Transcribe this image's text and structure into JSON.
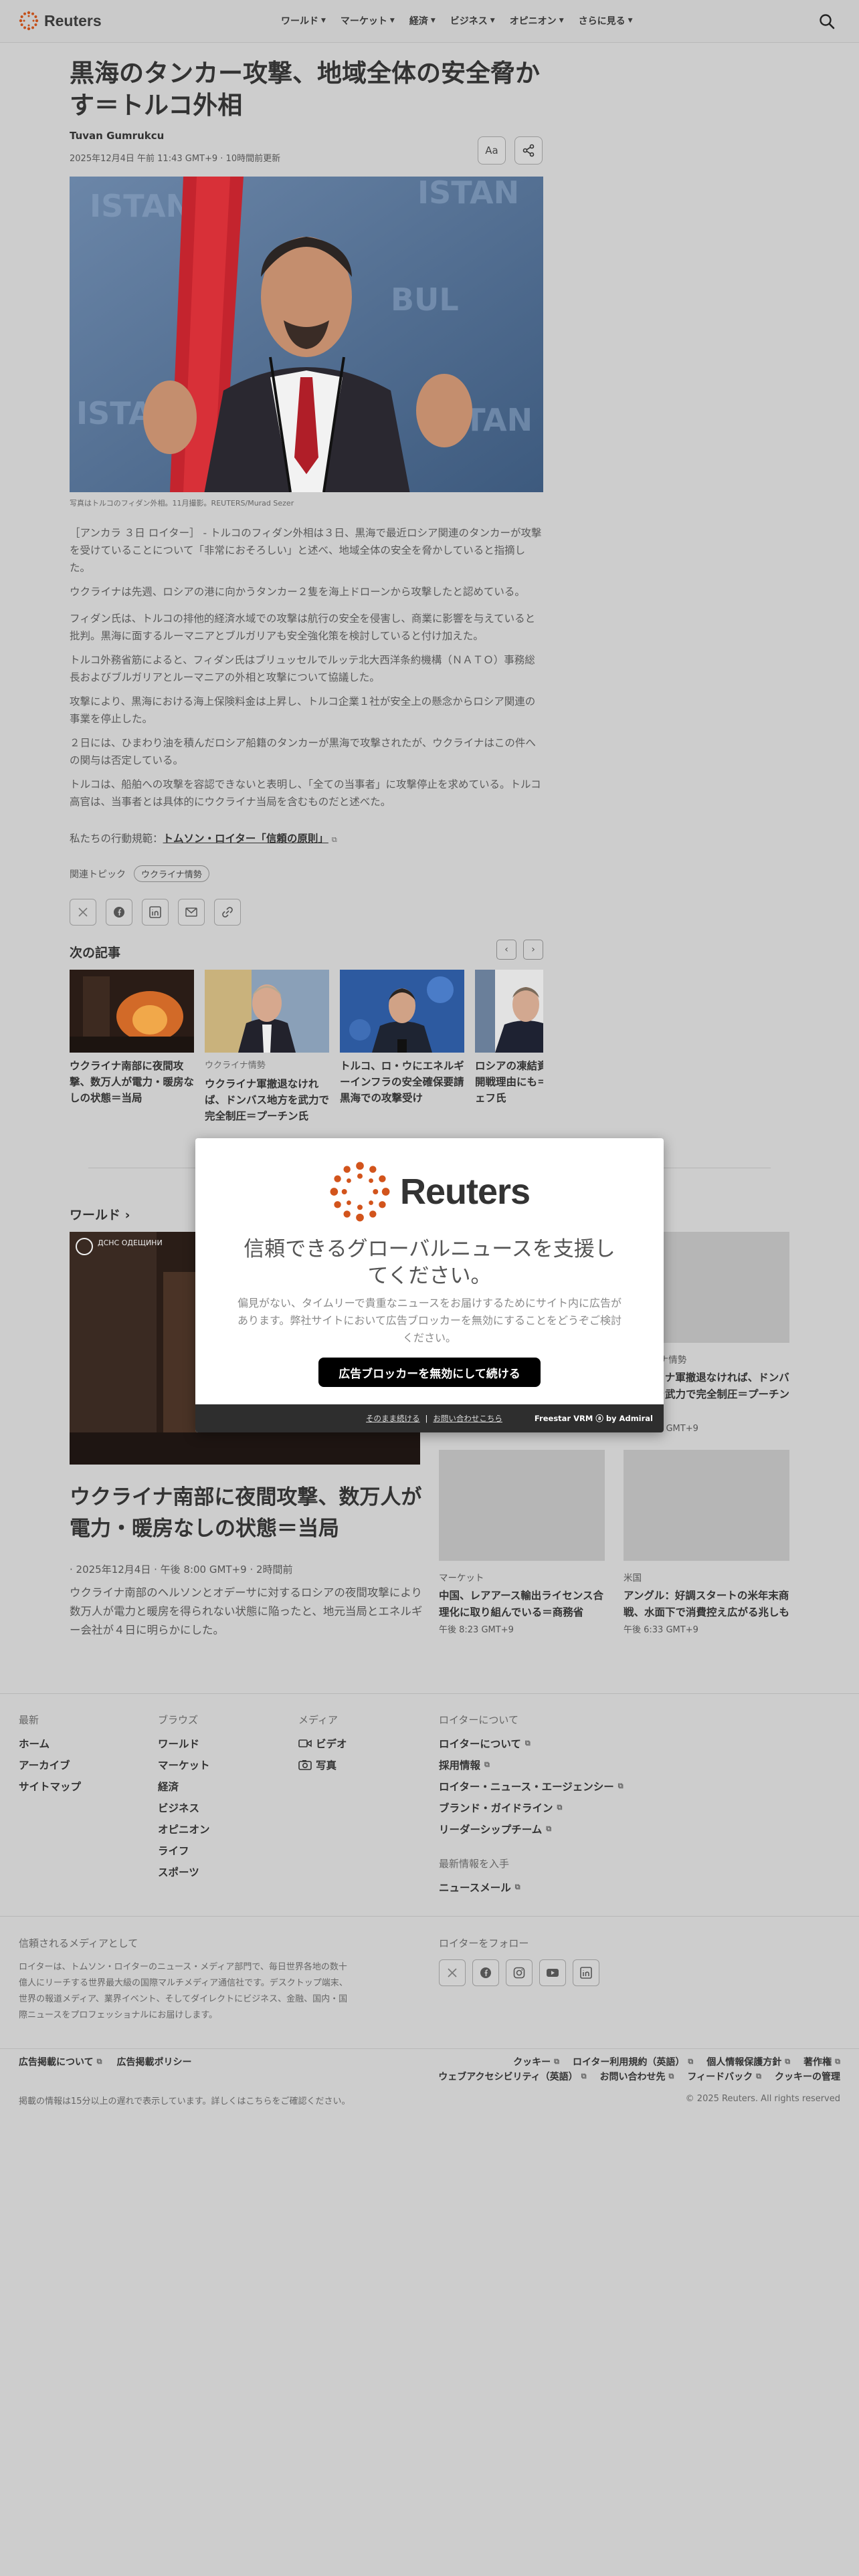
{
  "header": {
    "logo_text": "Reuters",
    "nav": [
      "ワールド",
      "マーケット",
      "経済",
      "ビジネス",
      "オピニオン",
      "さらに見る"
    ]
  },
  "article": {
    "headline": "黒海のタンカー攻撃、地域全体の安全脅かす＝トルコ外相",
    "author": "Tuvan Gumrukcu",
    "dateline": "2025年12月4日 午前 11:43 GMT+9 · 10時間前更新",
    "font_button": "Aa",
    "caption": "写真はトルコのフィダン外相。11月撮影。REUTERS/Murad Sezer",
    "paragraphs": [
      "［アンカラ ３日 ロイター］ - トルコのフィダン外相は３日、黒海で最近ロシア関連のタンカーが攻撃を受けていることについて「非常におそろしい」と述べ、地域全体の安全を脅かしていると指摘した。",
      "ウクライナは先週、ロシアの港に向かうタンカー２隻を海上ドローンから攻撃したと認めている。",
      "フィダン氏は、トルコの排他的経済水域での攻撃は航行の安全を侵害し、商業に影響を与えていると批判。黒海に面するルーマニアとブルガリアも安全強化策を検討していると付け加えた。",
      "トルコ外務省筋によると、フィダン氏はブリュッセルでルッテ北大西洋条約機構（ＮＡＴＯ）事務総長およびブルガリアとルーマニアの外相と攻撃について協議した。",
      "攻撃により、黒海における海上保険料金は上昇し、トルコ企業１社が安全上の懸念からロシア関連の事業を停止した。",
      "２日には、ひまわり油を積んだロシア船籍のタンカーが黒海で攻撃されたが、ウクライナはこの件への関与は否定している。",
      "トルコは、船舶への攻撃を容認できないと表明し、「全ての当事者」に攻撃停止を求めている。トルコ高官は、当事者とは具体的にウクライナ当局を含むものだと述べた。"
    ],
    "ethics_prefix": "私たちの行動規範：",
    "ethics_link": "トムソン・ロイター「信頼の原則」",
    "topics_label": "関連トピック",
    "topics_chip": "ウクライナ情勢"
  },
  "next_articles": {
    "title": "次の記事",
    "items": [
      {
        "kicker": "",
        "title": "ウクライナ南部に夜間攻撃、数万人が電力・暖房なしの状態＝当局"
      },
      {
        "kicker": "ウクライナ情勢",
        "title": "ウクライナ軍撤退なければ、ドンバス地方を武力で完全制圧＝プーチン氏"
      },
      {
        "kicker": "",
        "title": "トルコ、ロ・ウにエネルギーインフラの安全確保要請　黒海での攻撃受け"
      },
      {
        "kicker": "",
        "title": "ロシアの凍結資産押収なら開戦理由にも＝メドベージェフ氏"
      }
    ]
  },
  "world": {
    "title": "ワールド",
    "main_img_overlay": "ДСНС ОДЕЩИНИ",
    "main_title": "ウクライナ南部に夜間攻撃、数万人が電力・暖房なしの状態＝当局",
    "main_date": "· 2025年12月4日 · 午後 8:00 GMT+9 · 2時間前",
    "main_desc": "ウクライナ南部のヘルソンとオデーサに対するロシアの夜間攻撃により数万人が電力と暖房を得られない状態に陥ったと、地元当局とエネルギー会社が４日に明らかにした。",
    "side_cards": [
      {
        "kicker": "ウクライナ情勢",
        "title": "ウクライナ軍撤退なければ、ドンバス地方を武力で完全制圧＝プーチン氏",
        "date": "午後 7:41 GMT+9"
      },
      {
        "kicker": "マーケット",
        "title": "中国、レアアース輸出ライセンス合理化に取り組んでいる＝商務省",
        "date": "午後 8:23 GMT+9"
      },
      {
        "kicker": "米国",
        "title": "アングル：好調スタートの米年末商戦、水面下で消費控え広がる兆しも",
        "date": "午後 6:33 GMT+9"
      }
    ]
  },
  "footer": {
    "col1": {
      "head": "最新",
      "links": [
        "ホーム",
        "アーカイブ",
        "サイトマップ"
      ]
    },
    "col2": {
      "head": "ブラウズ",
      "links": [
        "ワールド",
        "マーケット",
        "経済",
        "ビジネス",
        "オピニオン",
        "ライフ",
        "スポーツ"
      ]
    },
    "col3": {
      "head": "メディア",
      "links": [
        "ビデオ",
        "写真"
      ]
    },
    "col4": {
      "head": "ロイターについて",
      "links": [
        "ロイターについて",
        "採用情報",
        "ロイター・ニュース・エージェンシー",
        "ブランド・ガイドライン",
        "リーダーシップチーム"
      ]
    },
    "latest": {
      "head": "最新情報を入手",
      "links": [
        "ニュースメール"
      ]
    },
    "trusted_head": "信頼されるメディアとして",
    "trusted_body": "ロイターは、トムソン・ロイターのニュース・メディア部門で、毎日世界各地の数十億人にリーチする世界最大級の国際マルチメディア通信社です。デスクトップ端末、世界の報道メディア、業界イベント、そしてダイレクトにビジネス、金融、国内・国際ニュースをプロフェッショナルにお届けします。",
    "follow_head": "ロイターをフォロー",
    "ads_links": [
      "広告掲載について",
      "広告掲載ポリシー"
    ],
    "legal_row1": [
      "クッキー",
      "ロイター利用規約（英語）",
      "個人情報保護方針",
      "著作権"
    ],
    "legal_row2": [
      "ウェブアクセシビリティ（英語）",
      "お問い合わせ先",
      "フィードバック",
      "クッキーの管理"
    ],
    "delay_note": "掲載の情報は15分以上の遅れで表示しています。詳しくはこちらをご確認ください。",
    "copyright": "© 2025 Reuters. All rights reserved"
  },
  "modal": {
    "logo_text": "Reuters",
    "title": "信頼できるグローバルニュースを支援してください。",
    "body": "偏見がない、タイムリーで貴重なニュースをお届けするためにサイト内に広告があります。弊社サイトにおいて広告ブロッカーを無効にすることをどうぞご検討ください。",
    "cta": "広告ブロッカーを無効にして続ける",
    "continue": "そのまま続ける",
    "contact": "お問い合わせこちら",
    "brand": "Freestar VRM",
    "brand_suffix": "by Admiral"
  }
}
